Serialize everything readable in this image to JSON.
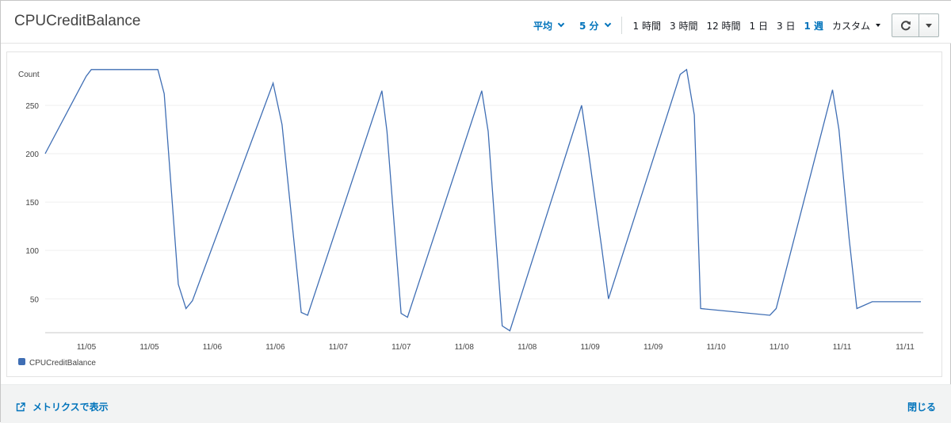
{
  "header": {
    "title": "CPUCreditBalance",
    "statistic": "平均",
    "period": "5 分",
    "ranges": [
      "1 時間",
      "3 時間",
      "12 時間",
      "1 日",
      "3 日",
      "1 週"
    ],
    "active_range": "1 週",
    "custom": "カスタム"
  },
  "icons": {
    "refresh": "refresh-icon",
    "dropdown": "caret-down-icon",
    "external": "external-link-icon"
  },
  "colors": {
    "accent": "#0073bb",
    "series": "#3f6eb4"
  },
  "footer": {
    "view_metrics": "メトリクスで表示",
    "close": "閉じる"
  },
  "chart_data": {
    "type": "line",
    "ylabel": "Count",
    "ylim": [
      15,
      295
    ],
    "yticks": [
      50,
      100,
      150,
      200,
      250
    ],
    "xticks": [
      "11/05",
      "11/05",
      "11/06",
      "11/06",
      "11/07",
      "11/07",
      "11/08",
      "11/08",
      "11/09",
      "11/09",
      "11/10",
      "11/10",
      "11/11",
      "11/11"
    ],
    "grid": true,
    "legend_position": "bottom-left",
    "series": [
      {
        "name": "CPUCreditBalance",
        "x": [
          0,
          0.32,
          0.36,
          0.88,
          0.93,
          1.04,
          1.1,
          1.15,
          1.78,
          1.85,
          2.0,
          2.05,
          2.63,
          2.67,
          2.78,
          2.83,
          3.41,
          3.46,
          3.57,
          3.63,
          4.19,
          4.24,
          4.35,
          4.4,
          4.96,
          5.01,
          5.07,
          5.12,
          5.66,
          5.71,
          6.15,
          6.2,
          6.28,
          6.34,
          6.46,
          6.53,
          6.84
        ],
        "y": [
          200,
          280,
          287,
          287,
          262,
          65,
          40,
          48,
          273,
          230,
          36,
          33,
          265,
          223,
          35,
          31,
          265,
          223,
          22,
          17,
          250,
          205,
          100,
          50,
          282,
          287,
          240,
          40,
          33,
          40,
          266,
          225,
          112,
          40,
          47,
          47,
          47
        ]
      }
    ]
  }
}
